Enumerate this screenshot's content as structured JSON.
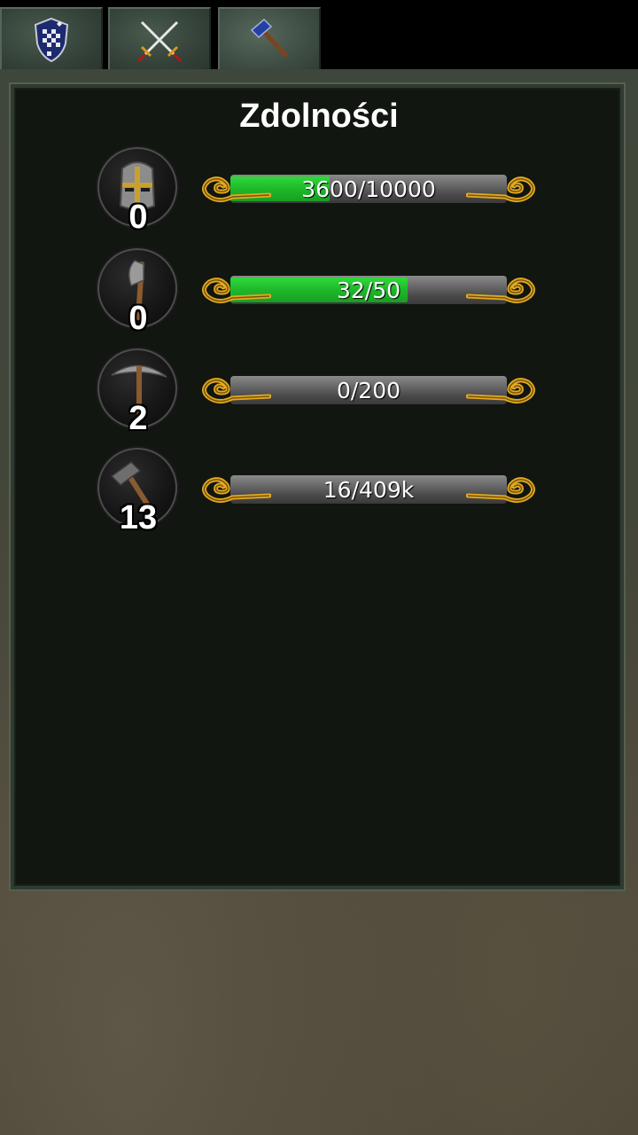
{
  "tabs": [
    {
      "icon": "shield-icon",
      "active": false
    },
    {
      "icon": "crossed-swords-icon",
      "active": false
    },
    {
      "icon": "hammer-icon",
      "active": true
    }
  ],
  "panel": {
    "title": "Zdolności"
  },
  "skills": [
    {
      "icon": "helmet-icon",
      "level": "0",
      "progress_text": "3600/10000",
      "progress": 0.36
    },
    {
      "icon": "axe-icon",
      "level": "0",
      "progress_text": "32/50",
      "progress": 0.64
    },
    {
      "icon": "pickaxe-icon",
      "level": "2",
      "progress_text": "0/200",
      "progress": 0.0
    },
    {
      "icon": "hammer-icon",
      "level": "13",
      "progress_text": "16/409k",
      "progress": 4e-05
    }
  ],
  "colors": {
    "progress_fill": "#22c22c",
    "ornament_gold": "#e0a820",
    "panel_bg": "#111610"
  }
}
